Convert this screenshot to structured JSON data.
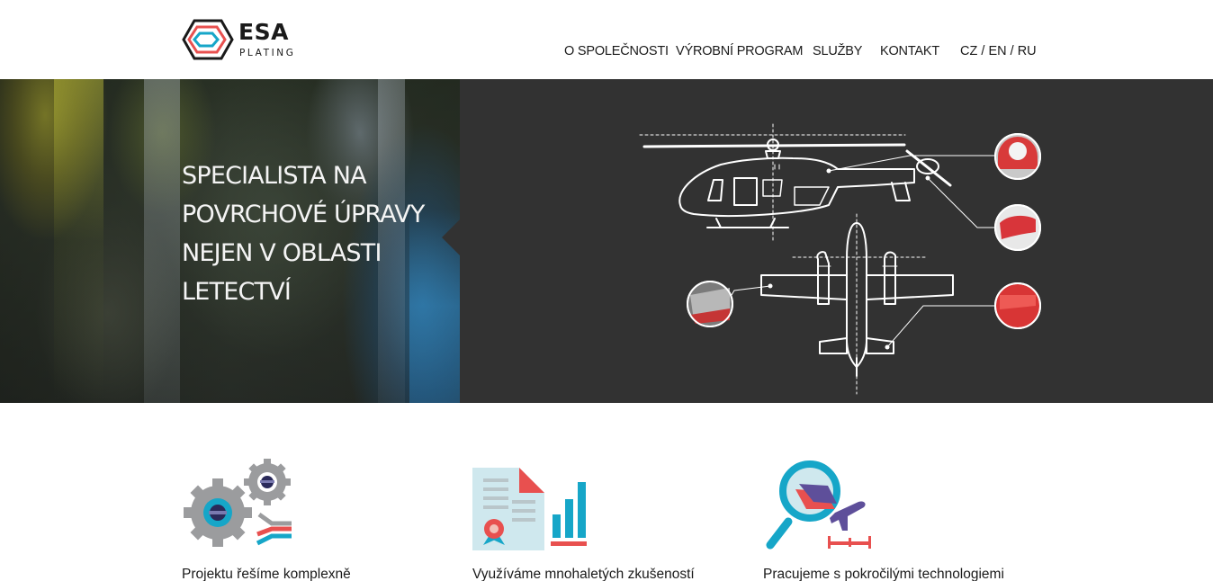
{
  "brand": {
    "name": "ESA",
    "tagline": "PLATING",
    "colors": {
      "red": "#e8504f",
      "blue": "#16a6c8",
      "dark": "#1a1a1a"
    }
  },
  "nav": {
    "items": [
      {
        "label": "O SPOLEČNOSTI"
      },
      {
        "label": "VÝROBNÍ PROGRAM"
      },
      {
        "label": "SLUŽBY"
      },
      {
        "label": "KONTAKT"
      }
    ],
    "languages": [
      "CZ",
      "EN",
      "RU"
    ],
    "lang_separator": "/"
  },
  "hero": {
    "title_lines": [
      "SPECIALISTA NA",
      "POVRCHOVÉ ÚPRAVY",
      "NEJEN V OBLASTI",
      "LETECTVÍ"
    ],
    "panel_color": "#323232"
  },
  "features": [
    {
      "icon": "gears-icon",
      "text": "Projektu řešíme komplexně"
    },
    {
      "icon": "certificate-chart-icon",
      "text": "Využíváme mnohaletých zkušeností"
    },
    {
      "icon": "magnifier-plane-icon",
      "text": "Pracujeme s pokročilými technologiemi"
    }
  ]
}
